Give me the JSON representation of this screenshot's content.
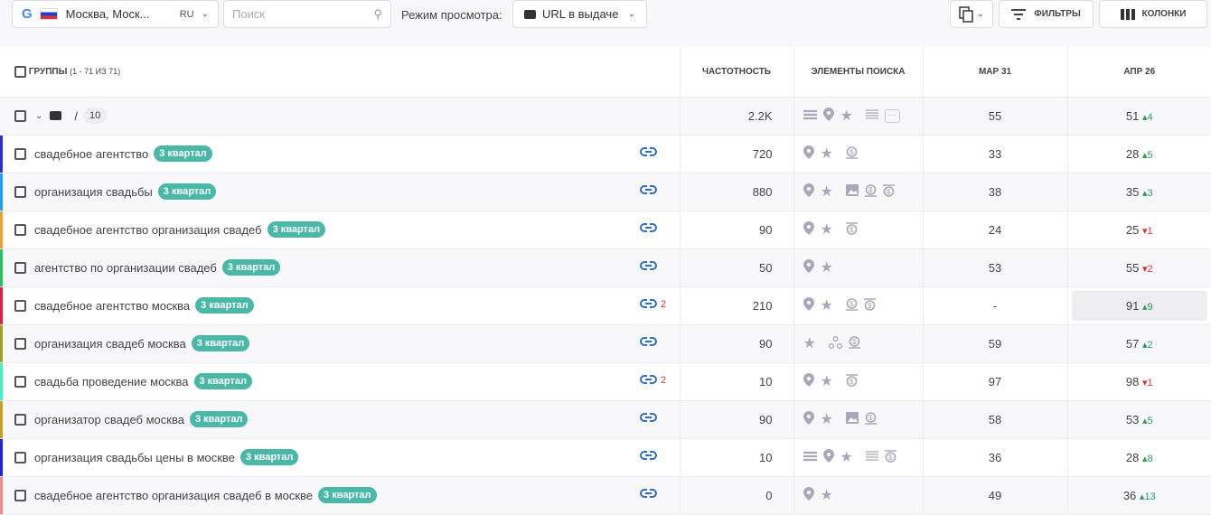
{
  "toolbar": {
    "location": "Москва, Моск...",
    "lang": "RU",
    "search_placeholder": "Поиск",
    "mode_label": "Режим просмотра:",
    "mode_value": "URL в выдаче",
    "filters": "ФИЛЬТРЫ",
    "columns": "КОЛОНКИ"
  },
  "header": {
    "groups": "ГРУППЫ",
    "groups_count": "(1 - 71 ИЗ 71)",
    "frequency": "ЧАСТОТНОСТЬ",
    "elements": "ЭЛЕМЕНТЫ ПОИСКА",
    "date1": "МАР 31",
    "date2": "АПР 26"
  },
  "group": {
    "path": "/",
    "count": "10",
    "frequency": "2.2K",
    "elements": [
      "list",
      "pin",
      "star",
      "lines",
      "more"
    ],
    "date1": "55",
    "date2": "51",
    "delta": "4",
    "dir": "up"
  },
  "colors": {
    "up": "#2a9a5a",
    "down": "#e03030",
    "tag": "#4ab8a6"
  },
  "rows": [
    {
      "keyword": "свадебное агентство",
      "tag": "3 квартал",
      "color": "#2b2be0",
      "links": "",
      "frequency": "720",
      "elements": [
        "pin",
        "star",
        "ad"
      ],
      "date1": "33",
      "date2": "28",
      "delta": "5",
      "dir": "up"
    },
    {
      "keyword": "организация свадьбы",
      "tag": "3 квартал",
      "color": "#1ea0f0",
      "links": "",
      "frequency": "880",
      "elements": [
        "pin",
        "star",
        "image",
        "ad",
        "adtop"
      ],
      "date1": "38",
      "date2": "35",
      "delta": "3",
      "dir": "up"
    },
    {
      "keyword": "свадебное агентство организация свадеб",
      "tag": "3 квартал",
      "color": "#f0a030",
      "links": "",
      "frequency": "90",
      "elements": [
        "pin",
        "star",
        "adtop"
      ],
      "date1": "24",
      "date2": "25",
      "delta": "1",
      "dir": "down"
    },
    {
      "keyword": "агентство по организации свадеб",
      "tag": "3 квартал",
      "color": "#28c060",
      "links": "",
      "frequency": "50",
      "elements": [
        "pin",
        "star"
      ],
      "date1": "53",
      "date2": "55",
      "delta": "2",
      "dir": "down"
    },
    {
      "keyword": "свадебное агентство москва",
      "tag": "3 квартал",
      "color": "#e02040",
      "links": "2",
      "frequency": "210",
      "elements": [
        "pin",
        "star",
        "ad",
        "adtop"
      ],
      "date1": "-",
      "date2": "91",
      "delta": "9",
      "dir": "up",
      "highlight": true
    },
    {
      "keyword": "организация свадеб москва",
      "tag": "3 квартал",
      "color": "#a0a020",
      "links": "",
      "frequency": "90",
      "elements": [
        "star",
        "graph",
        "ad"
      ],
      "date1": "59",
      "date2": "57",
      "delta": "2",
      "dir": "up"
    },
    {
      "keyword": "свадьба проведение москва",
      "tag": "3 квартал",
      "color": "#40f0c0",
      "links": "2",
      "frequency": "10",
      "elements": [
        "pin",
        "star",
        "adtop"
      ],
      "date1": "97",
      "date2": "98",
      "delta": "1",
      "dir": "down"
    },
    {
      "keyword": "организатор свадеб москва",
      "tag": "3 квартал",
      "color": "#c8a020",
      "links": "",
      "frequency": "90",
      "elements": [
        "pin",
        "star",
        "image",
        "ad"
      ],
      "date1": "58",
      "date2": "53",
      "delta": "5",
      "dir": "up"
    },
    {
      "keyword": "организация свадьбы цены в москве",
      "tag": "3 квартал",
      "color": "#2020e0",
      "links": "",
      "frequency": "10",
      "elements": [
        "list",
        "pin",
        "star",
        "lines",
        "adtop"
      ],
      "date1": "36",
      "date2": "28",
      "delta": "8",
      "dir": "up"
    },
    {
      "keyword": "свадебное агентство организация свадеб в москве",
      "tag": "3 квартал",
      "color": "#f08888",
      "links": "",
      "frequency": "0",
      "elements": [
        "pin",
        "star"
      ],
      "date1": "49",
      "date2": "36",
      "delta": "13",
      "dir": "up"
    }
  ]
}
